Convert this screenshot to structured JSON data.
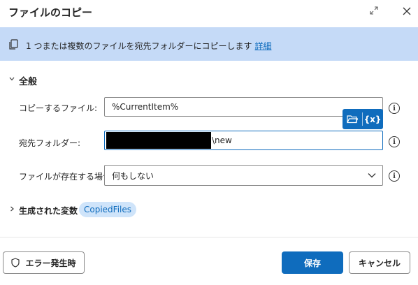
{
  "dialog": {
    "title": "ファイルのコピー"
  },
  "banner": {
    "text": "1 つまたは複数のファイルを宛先フォルダーにコピーします",
    "link": "詳細"
  },
  "section": {
    "title": "全般"
  },
  "fields": {
    "source": {
      "label": "コピーするファイル:",
      "value": "%CurrentItem%"
    },
    "destination": {
      "label": "宛先フォルダー:",
      "value": "\\new"
    },
    "if_exists": {
      "label": "ファイルが存在する場合:",
      "value": "何もしない"
    }
  },
  "actions": {
    "variable_label": "{x}"
  },
  "variables": {
    "title": "生成された変数",
    "items": [
      "CopiedFiles"
    ]
  },
  "footer": {
    "on_error": "エラー発生時",
    "save": "保存",
    "cancel": "キャンセル"
  },
  "colors": {
    "accent": "#0f6cbd",
    "banner_bg": "#c5daf7",
    "pill_bg": "#cfe4fa"
  }
}
